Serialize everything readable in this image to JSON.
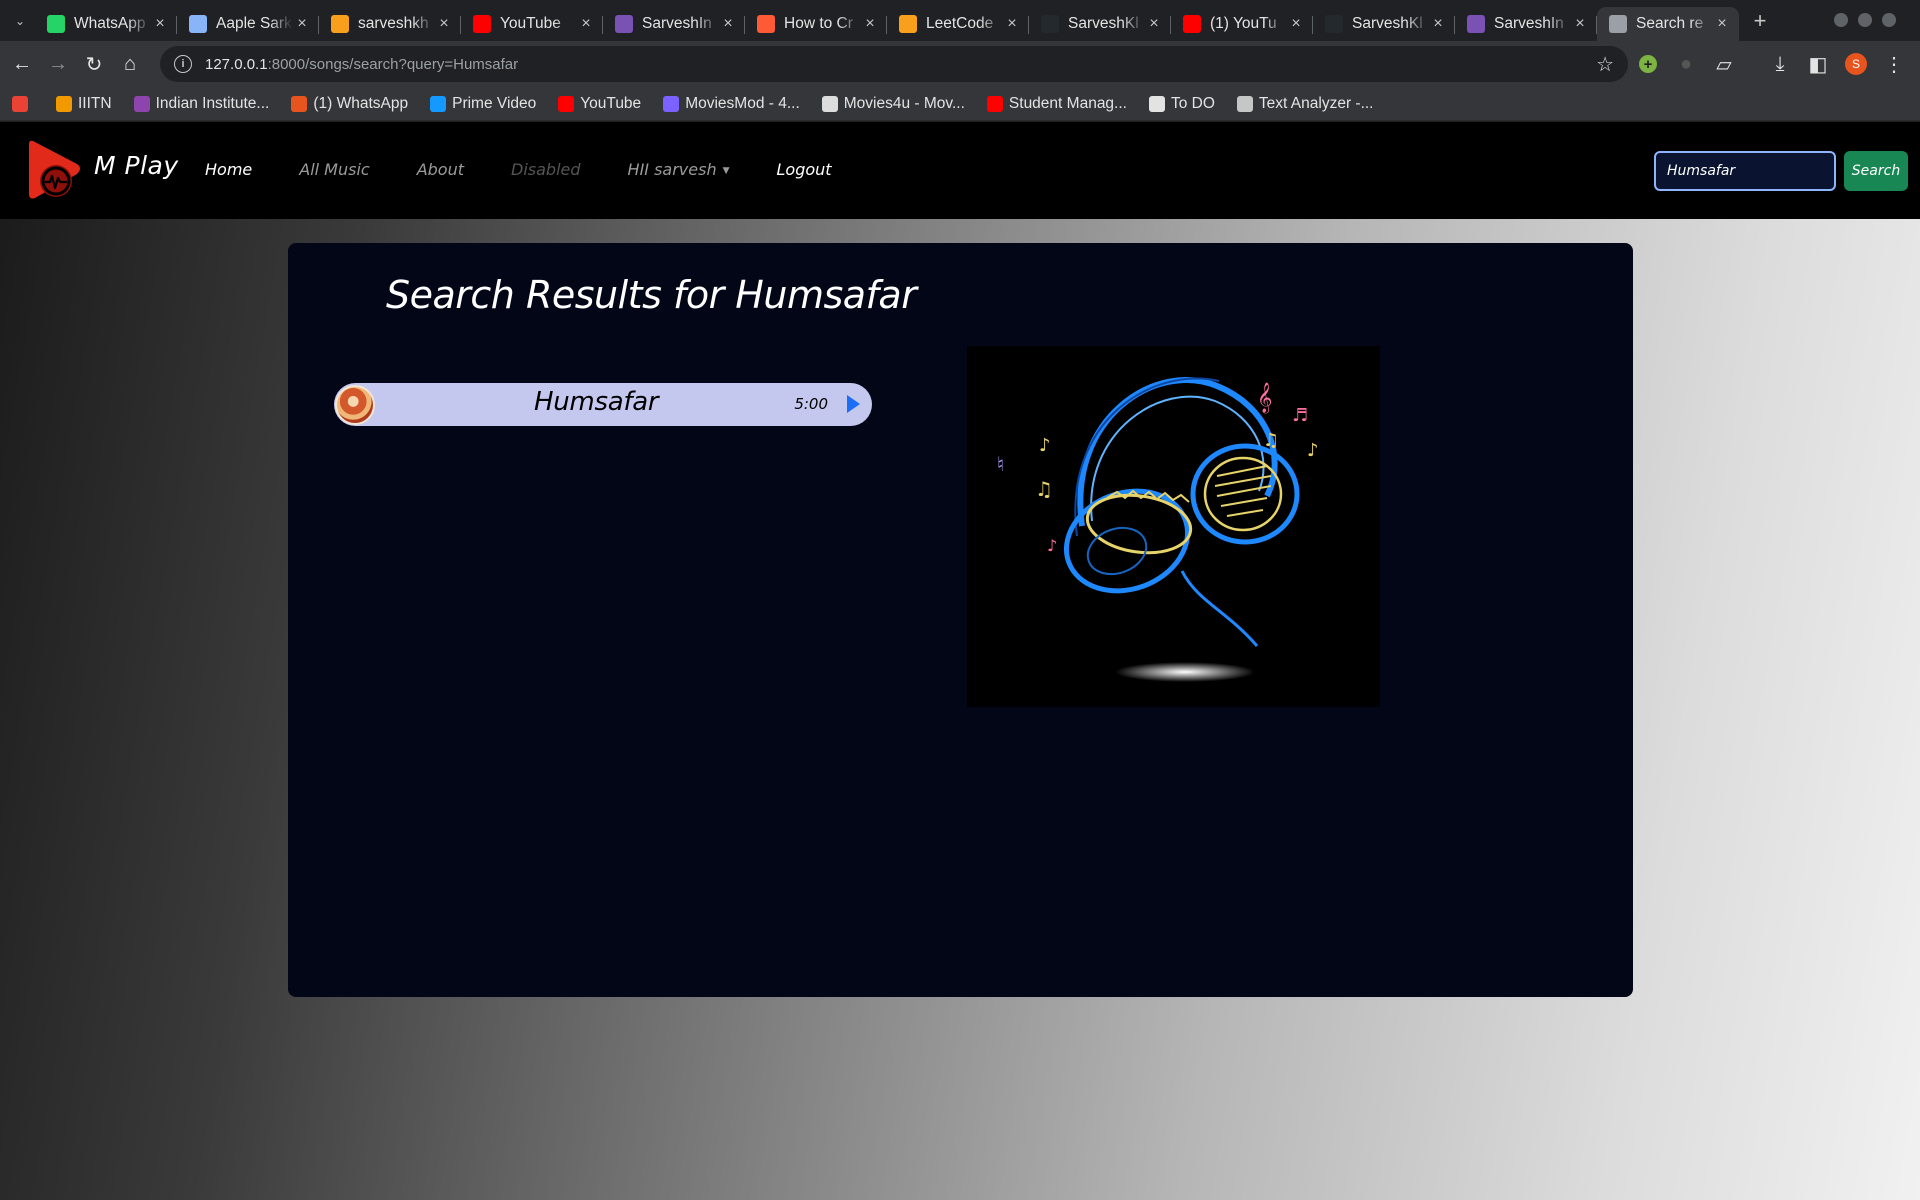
{
  "browser": {
    "tabs": [
      {
        "title": "WhatsApp",
        "icon": "whatsapp-icon",
        "color": "#25d366"
      },
      {
        "title": "Aaple Sarkar",
        "icon": "document-icon",
        "color": "#8ab4f8"
      },
      {
        "title": "sarveshkh",
        "icon": "leetcode-icon",
        "color": "#f89f1b"
      },
      {
        "title": "YouTube",
        "icon": "youtube-icon",
        "color": "#ff0000"
      },
      {
        "title": "SarveshIn",
        "icon": "bootstrap-icon",
        "color": "#7952b3"
      },
      {
        "title": "How to Cr",
        "icon": "hackernoon-icon",
        "color": "#ff5a36"
      },
      {
        "title": "LeetCode",
        "icon": "leetcode-icon",
        "color": "#f89f1b"
      },
      {
        "title": "SarveshKl",
        "icon": "github-icon",
        "color": "#24292e"
      },
      {
        "title": "(1) YouTu",
        "icon": "youtube-icon",
        "color": "#ff0000"
      },
      {
        "title": "SarveshKl",
        "icon": "github-icon",
        "color": "#24292e"
      },
      {
        "title": "SarveshIn",
        "icon": "bootstrap-icon",
        "color": "#7952b3"
      },
      {
        "title": "Search re",
        "icon": "globe-icon",
        "color": "#9aa0a6",
        "active": true
      }
    ],
    "url_host": "127.0.0.1",
    "url_rest": ":8000/songs/search?query=Humsafar",
    "profile_initial": "S",
    "bookmarks": [
      {
        "label": "",
        "icon": "gmail-icon",
        "color": "#ea4335"
      },
      {
        "label": "IIITN",
        "icon": "iiitn-icon",
        "color": "#f29900"
      },
      {
        "label": "Indian Institute...",
        "icon": "institute-icon",
        "color": "#8e44ad"
      },
      {
        "label": "(1) WhatsApp",
        "icon": "whatsapp-icon",
        "color": "#e8541e"
      },
      {
        "label": "Prime Video",
        "icon": "prime-video-icon",
        "color": "#1399ff"
      },
      {
        "label": "YouTube",
        "icon": "youtube-icon",
        "color": "#ff0000"
      },
      {
        "label": "MoviesMod - 4...",
        "icon": "moviesmod-icon",
        "color": "#7b61ff"
      },
      {
        "label": "Movies4u - Mov...",
        "icon": "movies4u-icon",
        "color": "#dddddd"
      },
      {
        "label": "Student Manag...",
        "icon": "youtube-icon",
        "color": "#ff0000"
      },
      {
        "label": "To DO",
        "icon": "globe-icon",
        "color": "#e3e3e3"
      },
      {
        "label": "Text Analyzer -...",
        "icon": "gear-icon",
        "color": "#c4c7c5"
      }
    ]
  },
  "nav": {
    "brand": "M Play",
    "links": [
      "Home",
      "All Music",
      "About",
      "Disabled",
      "HII sarvesh",
      "Logout"
    ],
    "search_value": "Humsafar",
    "search_button": "Search"
  },
  "results": {
    "title": "Search Results for Humsafar",
    "song": {
      "name": "Humsafar",
      "duration": "5:00"
    }
  },
  "colors": {
    "accent_search": "#198754",
    "song_row": "#c5c8ee",
    "play": "#1d6ef5",
    "panel": "#020617"
  }
}
